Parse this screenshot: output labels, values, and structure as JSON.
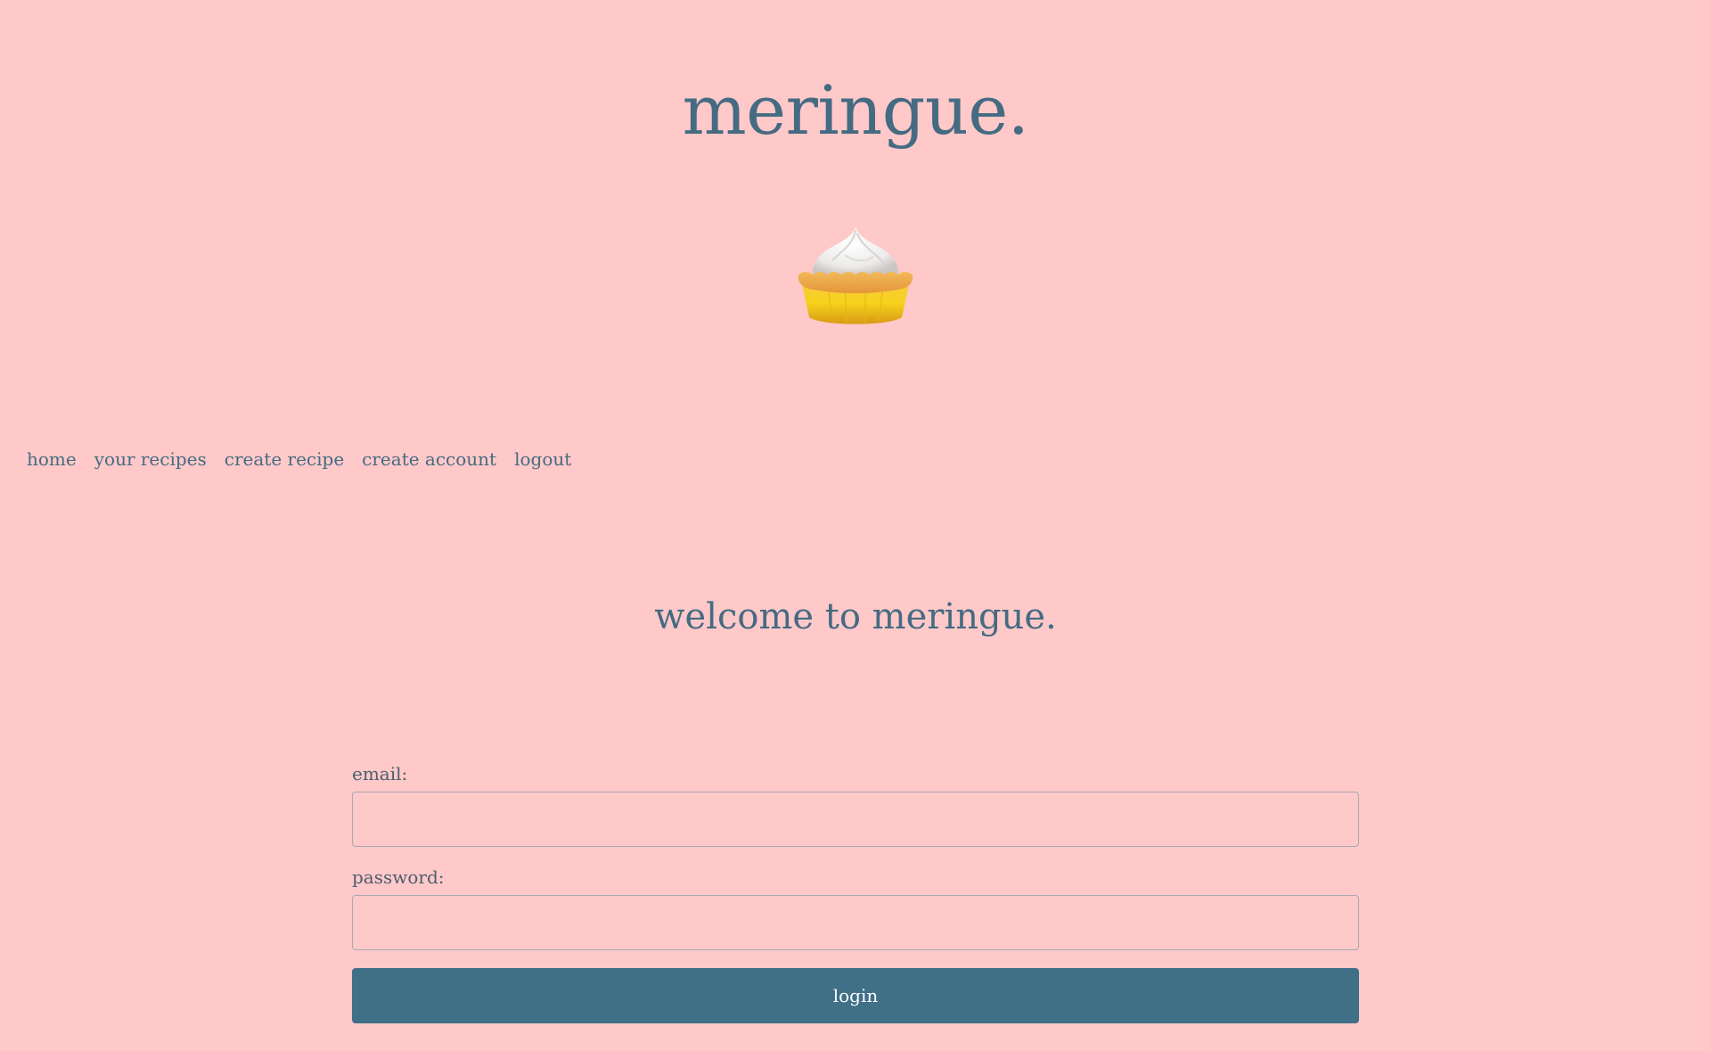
{
  "site": {
    "title": "meringue.",
    "logo_icon": "meringue-pie-icon"
  },
  "nav": {
    "items": [
      {
        "label": "home"
      },
      {
        "label": "your recipes"
      },
      {
        "label": "create recipe"
      },
      {
        "label": "create account"
      },
      {
        "label": "logout"
      }
    ]
  },
  "main": {
    "welcome": "welcome to meringue."
  },
  "login_form": {
    "email_label": "email:",
    "email_value": "",
    "password_label": "password:",
    "password_value": "",
    "submit_label": "login"
  },
  "colors": {
    "background": "#ffc9c9",
    "text": "#456b82",
    "button": "#3f7088"
  }
}
